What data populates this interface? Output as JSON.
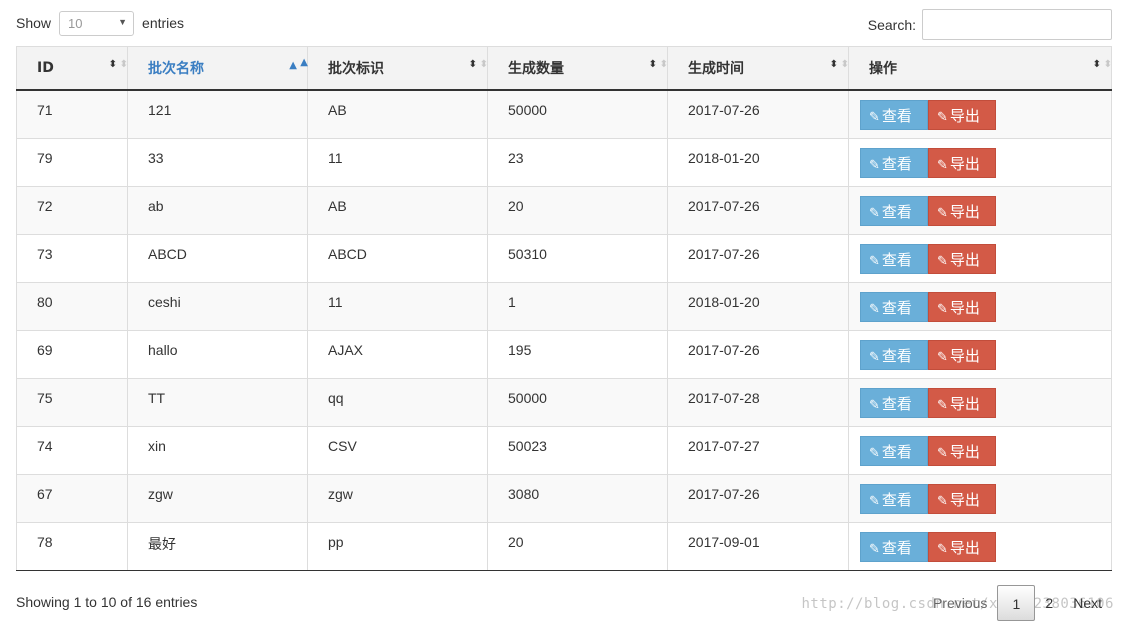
{
  "length_menu": {
    "prefix": "Show",
    "value": "10",
    "suffix": "entries"
  },
  "search": {
    "label": "Search:",
    "value": ""
  },
  "columns": [
    "ID",
    "批次名称",
    "批次标识",
    "生成数量",
    "生成时间",
    "操作"
  ],
  "sorted_column": "批次名称",
  "rows": [
    {
      "id": "71",
      "name": "121",
      "code": "AB",
      "qty": "50000",
      "time": "2017-07-26"
    },
    {
      "id": "79",
      "name": "33",
      "code": "11",
      "qty": "23",
      "time": "2018-01-20"
    },
    {
      "id": "72",
      "name": "ab",
      "code": "AB",
      "qty": "20",
      "time": "2017-07-26"
    },
    {
      "id": "73",
      "name": "ABCD",
      "code": "ABCD",
      "qty": "50310",
      "time": "2017-07-26"
    },
    {
      "id": "80",
      "name": "ceshi",
      "code": "11",
      "qty": "1",
      "time": "2018-01-20"
    },
    {
      "id": "69",
      "name": "hallo",
      "code": "AJAX",
      "qty": "195",
      "time": "2017-07-26"
    },
    {
      "id": "75",
      "name": "TT",
      "code": "qq",
      "qty": "50000",
      "time": "2017-07-28"
    },
    {
      "id": "74",
      "name": "xin",
      "code": "CSV",
      "qty": "50023",
      "time": "2017-07-27"
    },
    {
      "id": "67",
      "name": "zgw",
      "code": "zgw",
      "qty": "3080",
      "time": "2017-07-26"
    },
    {
      "id": "78",
      "name": "最好",
      "code": "pp",
      "qty": "20",
      "time": "2017-09-01"
    }
  ],
  "actions": {
    "view_label": "查看",
    "export_label": "导出",
    "view_icon": "edit-icon",
    "export_icon": "edit-icon"
  },
  "info": "Showing 1 to 10 of 16 entries",
  "pagination": {
    "previous": "Previous",
    "pages": [
      "1",
      "2"
    ],
    "current": "1",
    "next": "Next"
  },
  "watermark": "http://blog.csdn.net/xqt15238036106",
  "colors": {
    "view_button": "#6aafd9",
    "export_button": "#d35a47",
    "sorted_header": "#3a7ec2"
  }
}
